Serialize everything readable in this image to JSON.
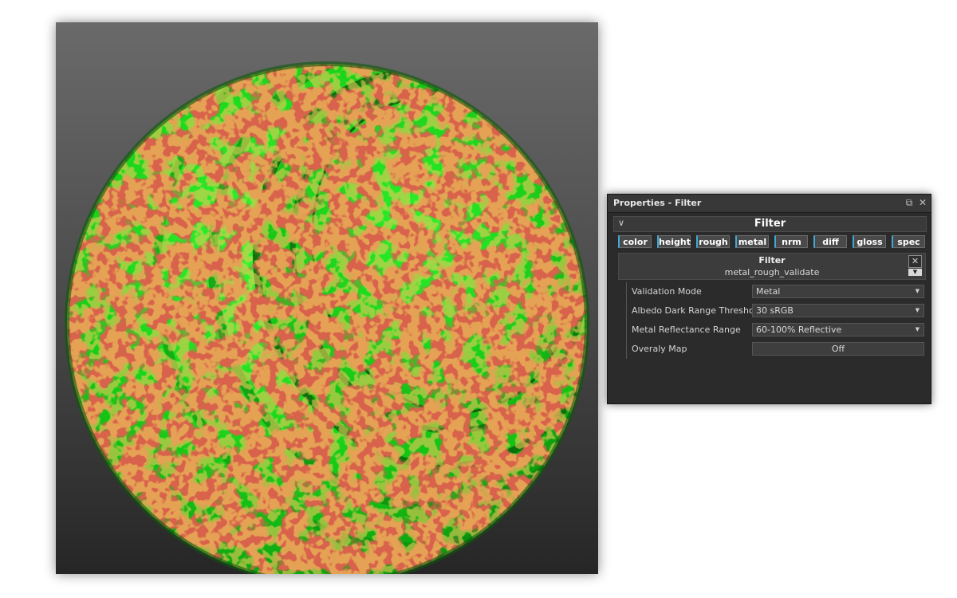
{
  "panel": {
    "title": "Properties - Filter",
    "section_title": "Filter",
    "channels": [
      "color",
      "height",
      "rough",
      "metal",
      "nrm",
      "diff",
      "gloss",
      "spec"
    ],
    "filter_label": "Filter",
    "filter_name": "metal_rough_validate",
    "params": [
      {
        "label": "Validation Mode",
        "value": "Metal",
        "type": "dropdown"
      },
      {
        "label": "Albedo Dark Range Threshold",
        "value": "30 sRGB",
        "type": "dropdown"
      },
      {
        "label": "Metal Reflectance Range",
        "value": "60-100% Reflective",
        "type": "dropdown"
      },
      {
        "label": "Overaly Map",
        "value": "Off",
        "type": "toggle"
      }
    ]
  },
  "icons": {
    "float": "popout-icon",
    "close": "close-icon",
    "collapse": "chevron-down-icon",
    "remove_filter": "close-icon",
    "dropdown": "dropdown-arrow-icon"
  },
  "colors": {
    "valid": "#1ed81e",
    "invalid": "#b01e12",
    "warning": "#d89a1c",
    "accent": "#3fa9d6"
  }
}
